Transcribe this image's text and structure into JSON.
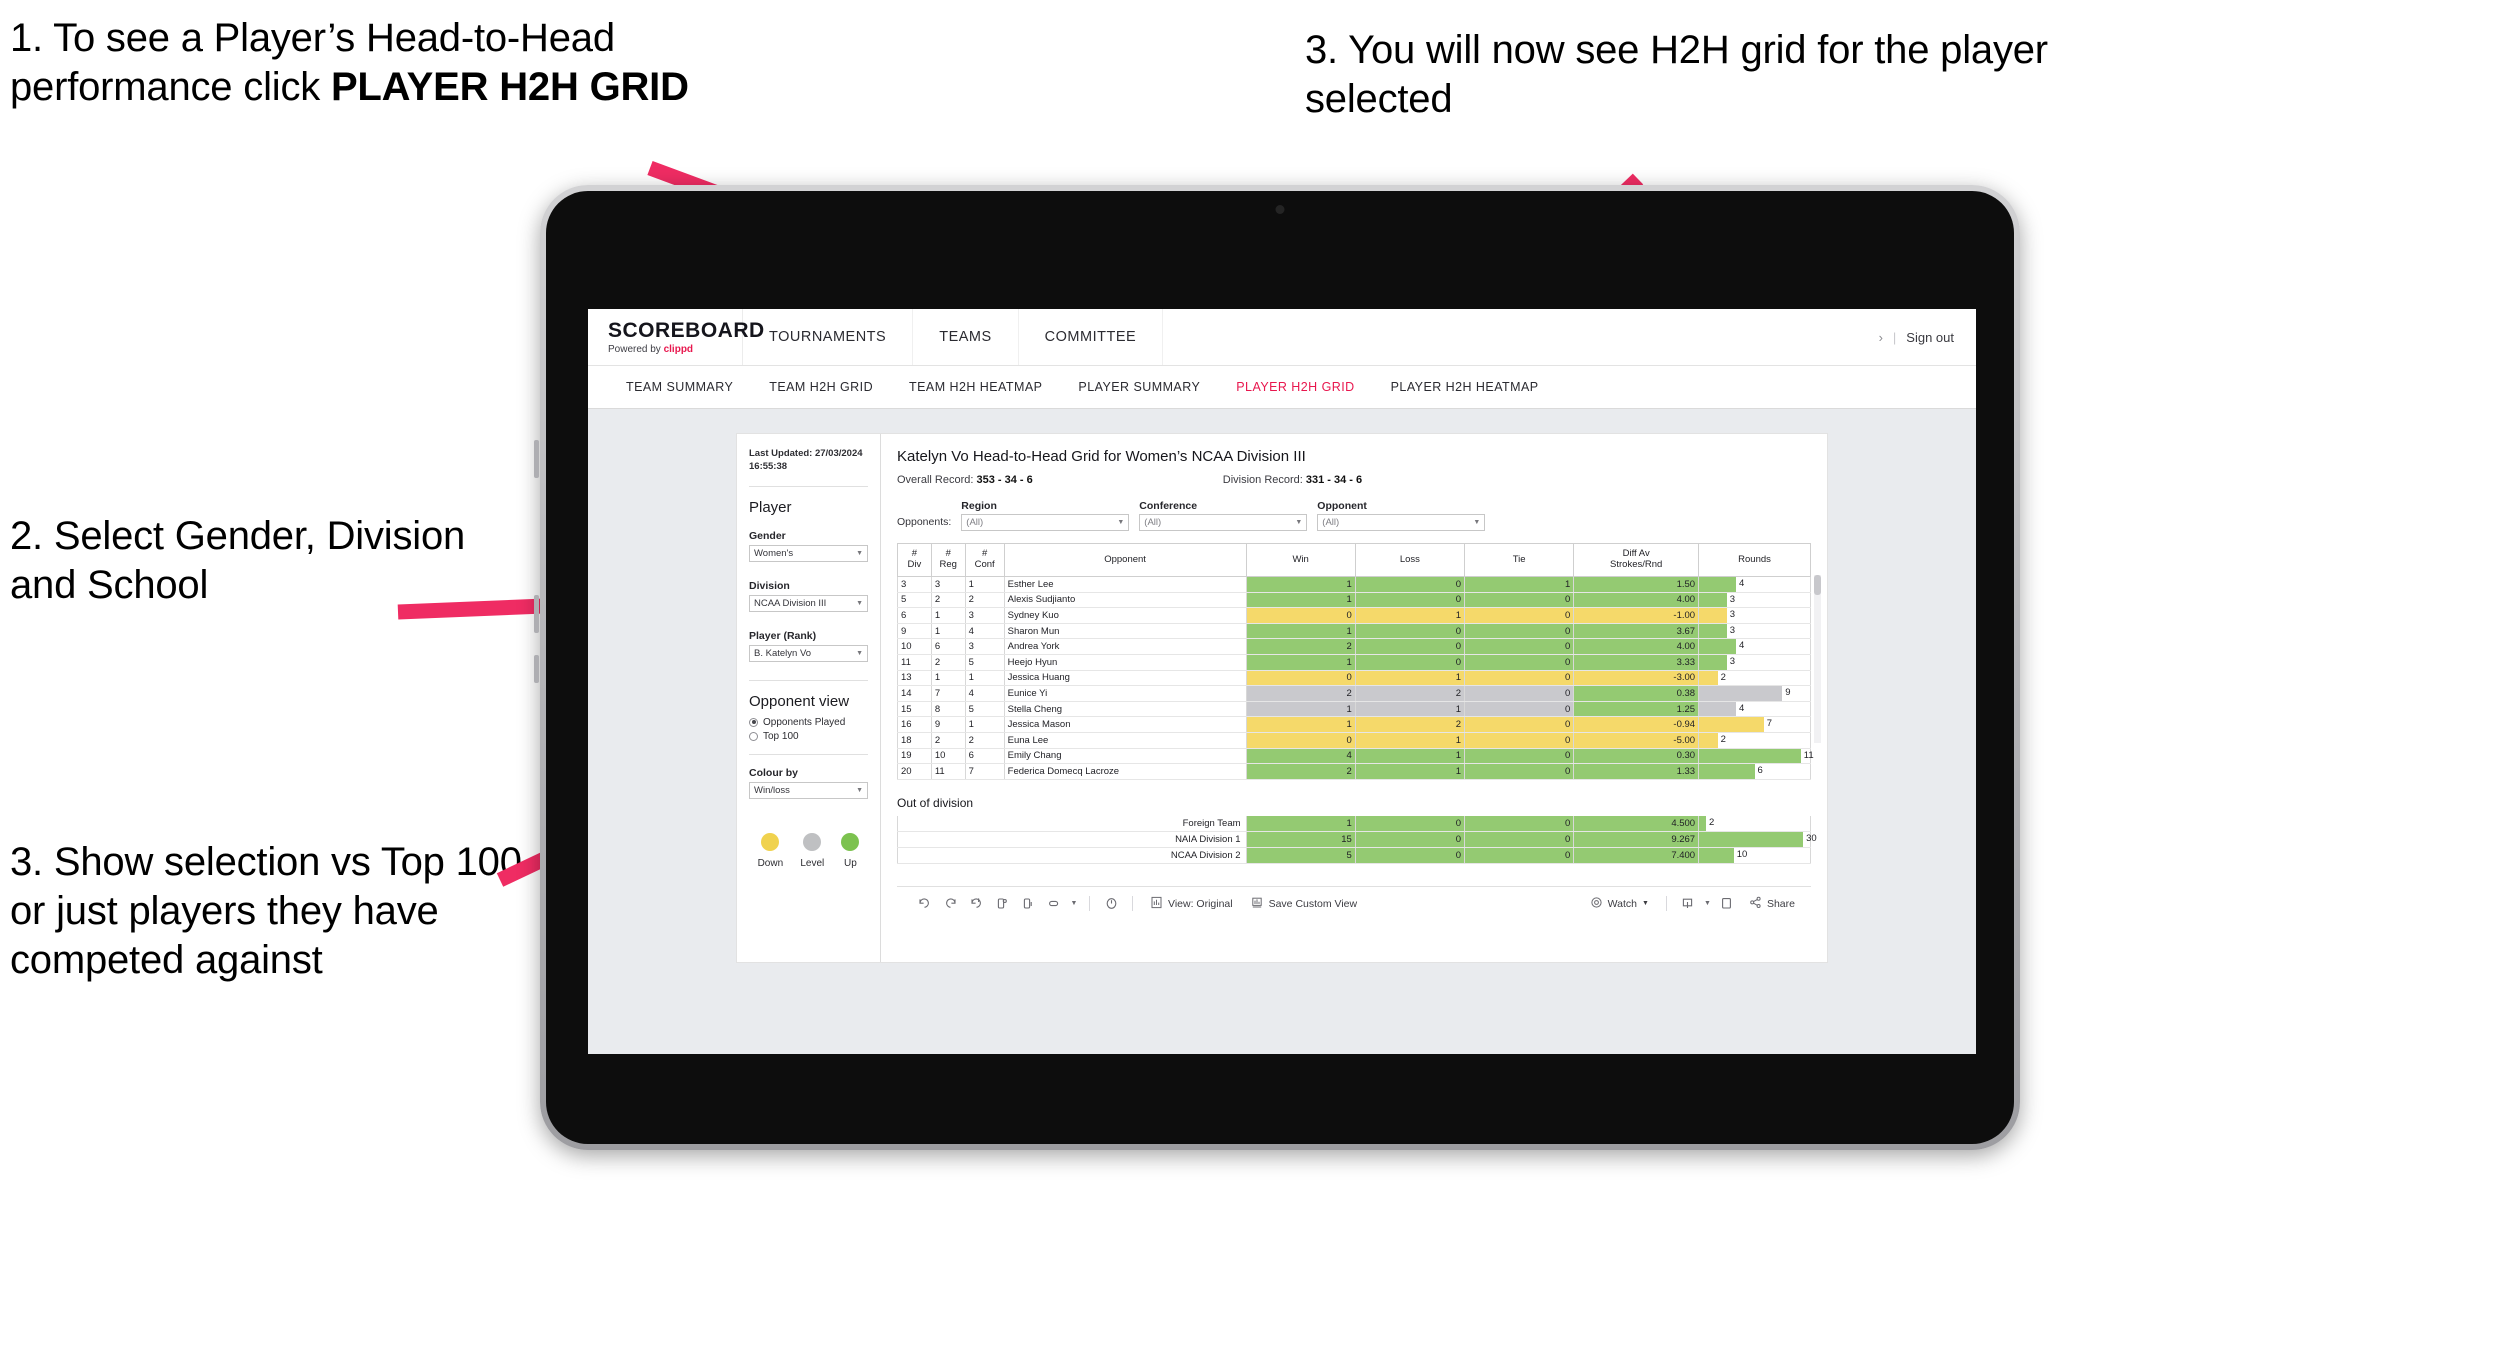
{
  "annotations": [
    {
      "id": "a1",
      "text_plain": "1. To see a Player’s Head-to-Head performance click ",
      "text_bold": "PLAYER H2H GRID"
    },
    {
      "id": "a2",
      "text": "2. Select Gender, Division and School"
    },
    {
      "id": "a3",
      "text": "3. Show selection vs Top 100 or just players they have competed against"
    },
    {
      "id": "a4",
      "text": "3. You will now see H2H grid for the player selected"
    }
  ],
  "colors": {
    "accent_pink": "#e8174e",
    "arrow_pink": "#ef2c63",
    "win_green": "#94ca72",
    "loss_yellow": "#f5d96a",
    "level_grey": "#c9c9cd",
    "legend_down": "#f0d24e",
    "legend_level": "#bfc0c2",
    "legend_up": "#7cc24f"
  },
  "app": {
    "logo": {
      "title": "SCOREBOARD",
      "powered": "Powered by ",
      "brand": "clippd"
    },
    "topnav": [
      "TOURNAMENTS",
      "TEAMS",
      "COMMITTEE"
    ],
    "header_right": {
      "chevron": "›",
      "separator": "|",
      "signout": "Sign out"
    },
    "subnav": {
      "tabs": [
        "TEAM SUMMARY",
        "TEAM H2H GRID",
        "TEAM H2H HEATMAP",
        "PLAYER SUMMARY",
        "PLAYER H2H GRID",
        "PLAYER H2H HEATMAP"
      ],
      "active": "PLAYER H2H GRID"
    }
  },
  "sidebar": {
    "last_updated": "Last Updated: 27/03/2024 16:55:38",
    "player_heading": "Player",
    "filters": [
      {
        "label": "Gender",
        "value": "Women's"
      },
      {
        "label": "Division",
        "value": "NCAA Division III"
      },
      {
        "label": "Player (Rank)",
        "value": "B. Katelyn Vo"
      }
    ],
    "opponent_view": {
      "heading": "Opponent view",
      "options": [
        {
          "label": "Opponents Played",
          "selected": true
        },
        {
          "label": "Top 100",
          "selected": false
        }
      ]
    },
    "colour_by": {
      "label": "Colour by",
      "value": "Win/loss"
    },
    "legend": [
      {
        "caption": "Down",
        "color": "#f0d24e"
      },
      {
        "caption": "Level",
        "color": "#bfc0c2"
      },
      {
        "caption": "Up",
        "color": "#7cc24f"
      }
    ]
  },
  "main": {
    "title": "Katelyn Vo Head-to-Head Grid for Women’s NCAA Division III",
    "overall_record_label": "Overall Record: ",
    "overall_record_value": "353 -  34 - 6",
    "division_record_label": "Division Record: ",
    "division_record_value": "331 -  34 - 6",
    "opponents_label": "Opponents:",
    "opponent_filters": [
      {
        "label": "Region",
        "value": "(All)"
      },
      {
        "label": "Conference",
        "value": "(All)"
      },
      {
        "label": "Opponent",
        "value": "(All)"
      }
    ],
    "out_of_division_title": "Out of division"
  },
  "chart_data": {
    "type": "table",
    "title": "Katelyn Vo Head-to-Head Grid for Women’s NCAA Division III",
    "columns": [
      "# Div",
      "# Reg",
      "# Conf",
      "Opponent",
      "Win",
      "Loss",
      "Tie",
      "Diff Av Strokes/Rnd",
      "Rounds"
    ],
    "column_lines": [
      [
        "#",
        "Div"
      ],
      [
        "#",
        "Reg"
      ],
      [
        "#",
        "Conf"
      ],
      [
        "Opponent"
      ],
      [
        "Win"
      ],
      [
        "Loss"
      ],
      [
        "Tie"
      ],
      [
        "Diff Av",
        "Strokes/Rnd"
      ],
      [
        "Rounds"
      ]
    ],
    "rounds_max": 12,
    "rows": [
      {
        "div": "3",
        "reg": "3",
        "conf": "1",
        "opponent": "Esther Lee",
        "win": "1",
        "loss": "0",
        "tie": "1",
        "diff": "1.50",
        "rounds": "4",
        "state": "up"
      },
      {
        "div": "5",
        "reg": "2",
        "conf": "2",
        "opponent": "Alexis Sudjianto",
        "win": "1",
        "loss": "0",
        "tie": "0",
        "diff": "4.00",
        "rounds": "3",
        "state": "up"
      },
      {
        "div": "6",
        "reg": "1",
        "conf": "3",
        "opponent": "Sydney Kuo",
        "win": "0",
        "loss": "1",
        "tie": "0",
        "diff": "-1.00",
        "rounds": "3",
        "state": "down"
      },
      {
        "div": "9",
        "reg": "1",
        "conf": "4",
        "opponent": "Sharon Mun",
        "win": "1",
        "loss": "0",
        "tie": "0",
        "diff": "3.67",
        "rounds": "3",
        "state": "up"
      },
      {
        "div": "10",
        "reg": "6",
        "conf": "3",
        "opponent": "Andrea York",
        "win": "2",
        "loss": "0",
        "tie": "0",
        "diff": "4.00",
        "rounds": "4",
        "state": "up"
      },
      {
        "div": "11",
        "reg": "2",
        "conf": "5",
        "opponent": "Heejo Hyun",
        "win": "1",
        "loss": "0",
        "tie": "0",
        "diff": "3.33",
        "rounds": "3",
        "state": "up"
      },
      {
        "div": "13",
        "reg": "1",
        "conf": "1",
        "opponent": "Jessica Huang",
        "win": "0",
        "loss": "1",
        "tie": "0",
        "diff": "-3.00",
        "rounds": "2",
        "state": "down"
      },
      {
        "div": "14",
        "reg": "7",
        "conf": "4",
        "opponent": "Eunice Yi",
        "win": "2",
        "loss": "2",
        "tie": "0",
        "diff": "0.38",
        "rounds": "9",
        "state": "level",
        "diff_state": "up"
      },
      {
        "div": "15",
        "reg": "8",
        "conf": "5",
        "opponent": "Stella Cheng",
        "win": "1",
        "loss": "1",
        "tie": "0",
        "diff": "1.25",
        "rounds": "4",
        "state": "level",
        "diff_state": "up"
      },
      {
        "div": "16",
        "reg": "9",
        "conf": "1",
        "opponent": "Jessica Mason",
        "win": "1",
        "loss": "2",
        "tie": "0",
        "diff": "-0.94",
        "rounds": "7",
        "state": "down"
      },
      {
        "div": "18",
        "reg": "2",
        "conf": "2",
        "opponent": "Euna Lee",
        "win": "0",
        "loss": "1",
        "tie": "0",
        "diff": "-5.00",
        "rounds": "2",
        "state": "down"
      },
      {
        "div": "19",
        "reg": "10",
        "conf": "6",
        "opponent": "Emily Chang",
        "win": "4",
        "loss": "1",
        "tie": "0",
        "diff": "0.30",
        "rounds": "11",
        "state": "up"
      },
      {
        "div": "20",
        "reg": "11",
        "conf": "7",
        "opponent": "Federica Domecq Lacroze",
        "win": "2",
        "loss": "1",
        "tie": "0",
        "diff": "1.33",
        "rounds": "6",
        "state": "up"
      }
    ],
    "out_of_division": {
      "rounds_max": 32,
      "rows": [
        {
          "name": "Foreign Team",
          "win": "1",
          "loss": "0",
          "tie": "0",
          "diff": "4.500",
          "rounds": "2",
          "state": "up"
        },
        {
          "name": "NAIA Division 1",
          "win": "15",
          "loss": "0",
          "tie": "0",
          "diff": "9.267",
          "rounds": "30",
          "state": "up"
        },
        {
          "name": "NCAA Division 2",
          "win": "5",
          "loss": "0",
          "tie": "0",
          "diff": "7.400",
          "rounds": "10",
          "state": "up"
        }
      ]
    }
  },
  "toolbar": {
    "icons": [
      "undo-icon",
      "redo-icon",
      "revert-icon",
      "refresh-icon",
      "pause-icon",
      "swap-icon",
      "chevron-down-icon",
      "clock-icon"
    ],
    "view_label": "View: Original",
    "save_label": "Save Custom View",
    "watch_label": "Watch",
    "share_label": "Share",
    "download_icon": "download-icon",
    "fullscreen_icon": "fullscreen-icon"
  }
}
